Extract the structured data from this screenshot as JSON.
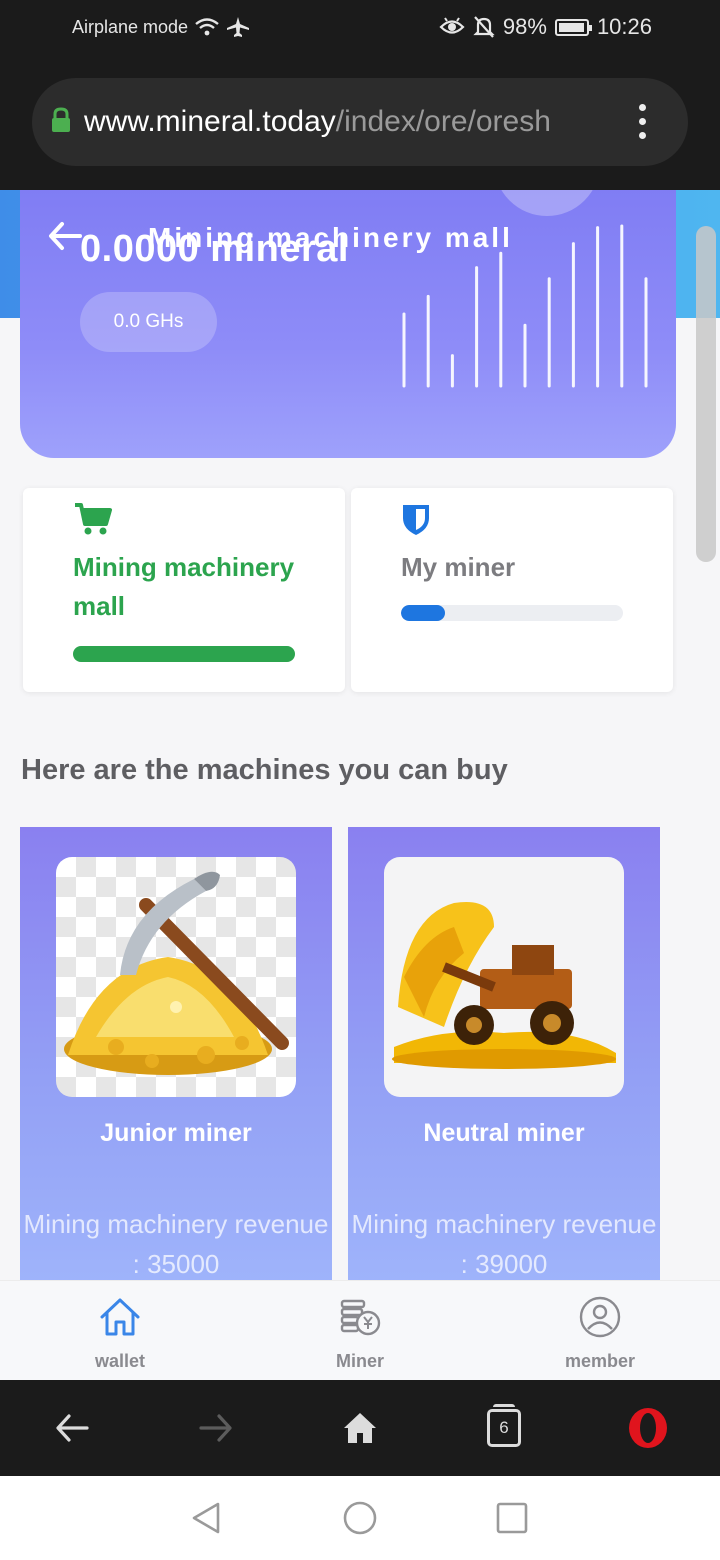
{
  "status_bar": {
    "left_text": "Airplane mode",
    "battery": "98%",
    "battery_level": 0.98,
    "time": "10:26",
    "icons": [
      "wifi-icon",
      "airplane-icon",
      "eye-icon",
      "bell-off-icon",
      "battery-icon"
    ]
  },
  "browser": {
    "url_domain": "www.mineral.today",
    "url_path": "/index/ore/oresh",
    "lock_color": "#4caf50"
  },
  "hero": {
    "balance": "0.0000 mineral",
    "title": "Mining machinery mall",
    "hashrate": "0.0 GHs",
    "chart_data": {
      "type": "bar",
      "bars": [
        0.45,
        0.56,
        0.19,
        0.74,
        0.83,
        0.38,
        0.67,
        0.89,
        0.99,
        1.0,
        0.67
      ]
    }
  },
  "cards": {
    "mall": {
      "label": "Mining machinery mall",
      "progress": 1.0,
      "color": "#2ca44e"
    },
    "my_miner": {
      "label": "My miner",
      "progress": 0.2,
      "color": "#1e76e0"
    }
  },
  "section": {
    "title": "Here are the machines you can buy"
  },
  "products": [
    {
      "name": "Junior miner",
      "revenue_text": "Mining machinery revenue : 35000"
    },
    {
      "name": "Neutral miner",
      "revenue_text": "Mining machinery revenue : 39000"
    }
  ],
  "tabbar": {
    "items": [
      {
        "label": "wallet",
        "icon": "house-icon",
        "active": true
      },
      {
        "label": "Miner",
        "icon": "miner-coins-icon",
        "active": false
      },
      {
        "label": "member",
        "icon": "user-circle-icon",
        "active": false
      }
    ]
  },
  "browser_bottom": {
    "tab_count": "6",
    "icons": [
      "back-arrow-icon",
      "forward-arrow-icon",
      "home-icon",
      "tabs-icon",
      "opera-icon"
    ]
  },
  "colors": {
    "hero_gradient_top": "#7f7cf3",
    "accent_green": "#2ca44e",
    "accent_blue": "#1e76e0",
    "tab_active": "#3a86e8"
  }
}
